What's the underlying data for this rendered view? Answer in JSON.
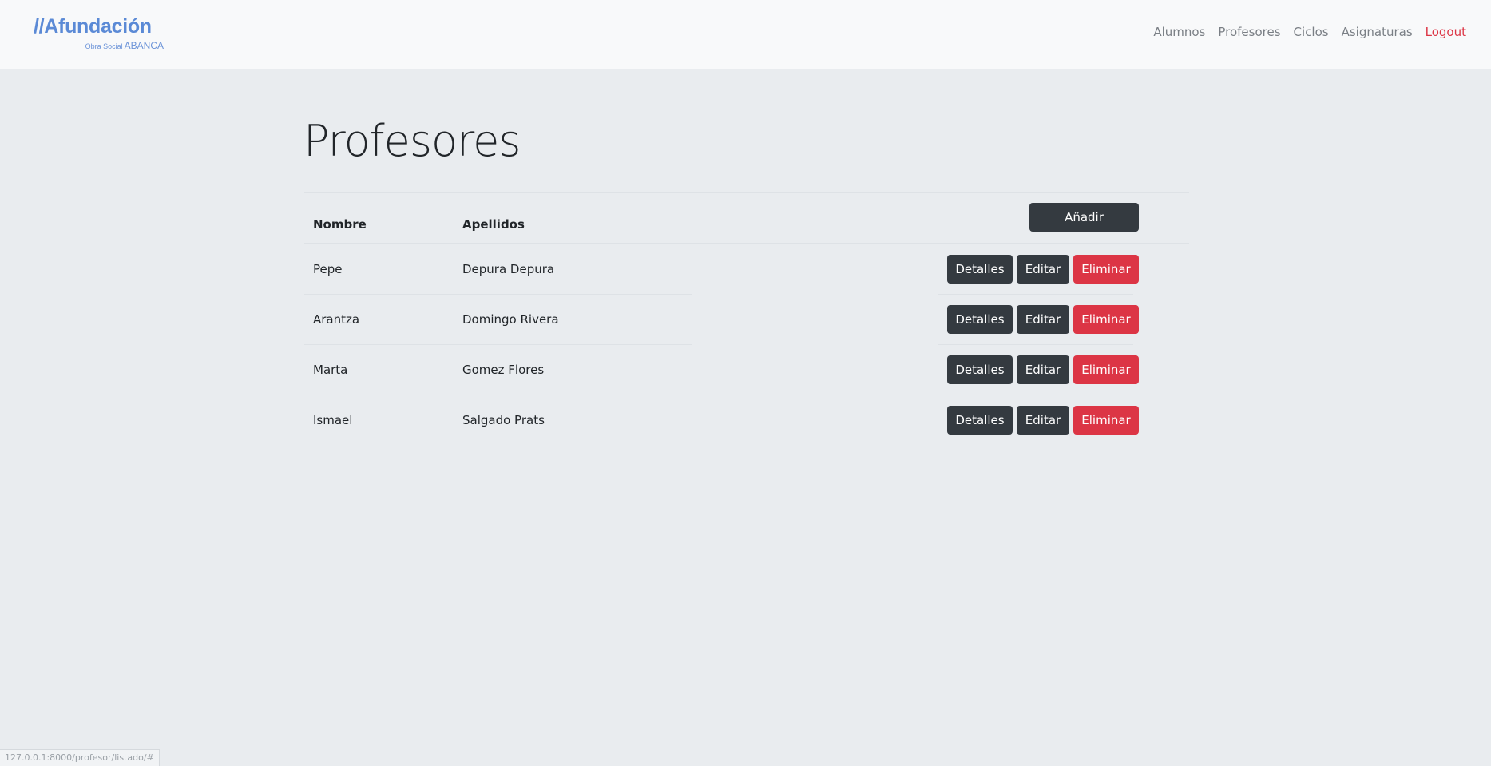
{
  "brand": {
    "name": "//Afundación",
    "subtitle_small": "Obra Social",
    "subtitle_strong": "ABANCA",
    "color": "#5b8ad6"
  },
  "nav": {
    "links": [
      "Alumnos",
      "Profesores",
      "Ciclos",
      "Asignaturas"
    ],
    "logout": "Logout"
  },
  "page": {
    "title": "Profesores"
  },
  "table": {
    "columns": [
      "Nombre",
      "Apellidos"
    ],
    "add_button": "Añadir",
    "rows": [
      {
        "nombre": "Pepe",
        "apellidos": "Depura Depura"
      },
      {
        "nombre": "Arantza",
        "apellidos": "Domingo Rivera"
      },
      {
        "nombre": "Marta",
        "apellidos": "Gomez Flores"
      },
      {
        "nombre": "Ismael",
        "apellidos": "Salgado Prats"
      }
    ],
    "actions": {
      "details": "Detalles",
      "edit": "Editar",
      "delete": "Eliminar"
    }
  },
  "status_bar": {
    "url": "127.0.0.1:8000/profesor/listado/#"
  },
  "colors": {
    "dark_button": "#343a40",
    "danger_button": "#dc3545",
    "background": "#e9ecef",
    "navbar": "#f8f9fa"
  }
}
